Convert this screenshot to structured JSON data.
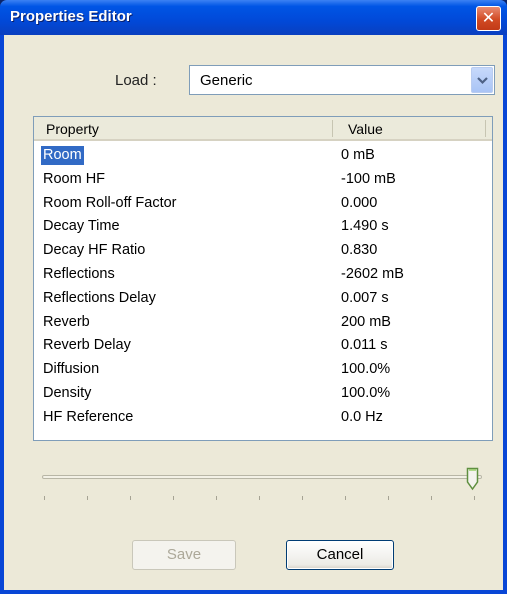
{
  "window": {
    "title": "Properties Editor",
    "close_glyph": "✕"
  },
  "load": {
    "label": "Load :",
    "selected": "Generic"
  },
  "table": {
    "columns": [
      "Property",
      "Value"
    ],
    "selected_row": "Room",
    "rows": [
      {
        "property": "Room",
        "value": "0 mB"
      },
      {
        "property": "Room HF",
        "value": "-100 mB"
      },
      {
        "property": "Room Roll-off Factor",
        "value": "0.000"
      },
      {
        "property": "Decay Time",
        "value": "1.490 s"
      },
      {
        "property": "Decay HF Ratio",
        "value": "0.830"
      },
      {
        "property": "Reflections",
        "value": "-2602 mB"
      },
      {
        "property": "Reflections Delay",
        "value": "0.007 s"
      },
      {
        "property": "Reverb",
        "value": "200 mB"
      },
      {
        "property": "Reverb Delay",
        "value": "0.011 s"
      },
      {
        "property": "Diffusion",
        "value": "100.0%"
      },
      {
        "property": "Density",
        "value": "100.0%"
      },
      {
        "property": "HF Reference",
        "value": "0.0 Hz"
      }
    ]
  },
  "slider": {
    "position_fraction": 1.0,
    "tick_count": 11
  },
  "buttons": {
    "save_label": "Save",
    "save_enabled": false,
    "cancel_label": "Cancel"
  },
  "colors": {
    "titlebar": "#0055e5",
    "selection": "#316ac5",
    "dialog_face": "#ece9d8",
    "close_button": "#d14a23"
  },
  "icons": {
    "close": "close-icon",
    "dropdown": "chevron-down-icon",
    "slider_thumb": "slider-thumb-icon"
  }
}
